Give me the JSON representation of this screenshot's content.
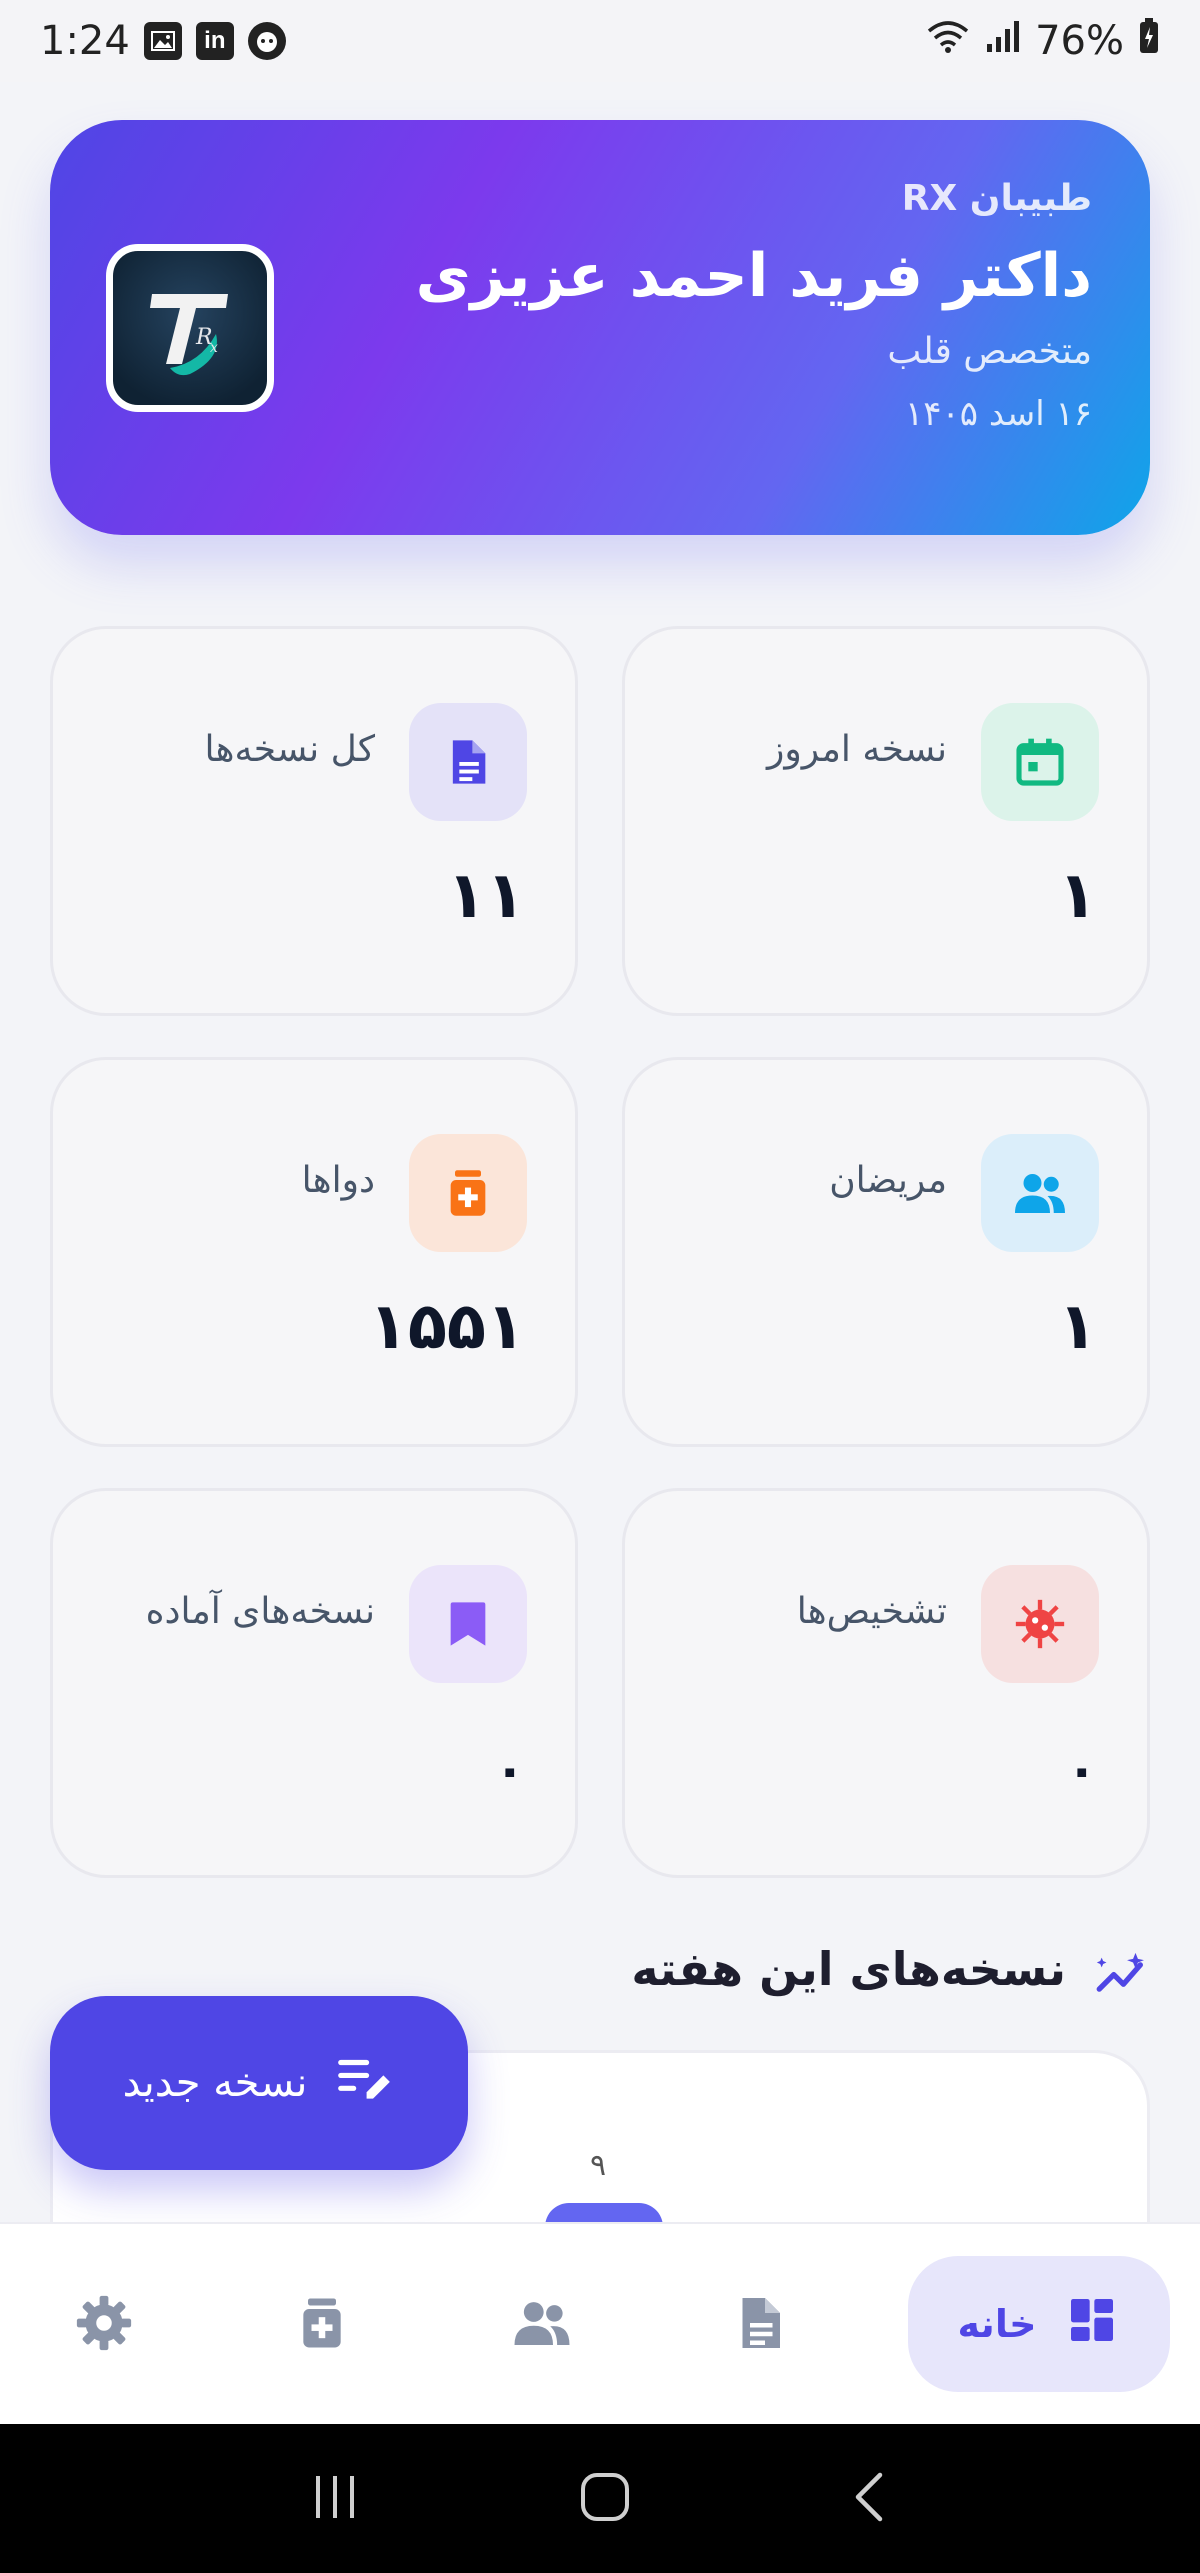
{
  "status_bar": {
    "time": "1:24",
    "battery": "76%"
  },
  "header": {
    "app_name": "طبیبان RX",
    "doctor_name": "داکتر فرید احمد عزیزی",
    "specialty": "متخصص قلب",
    "date": "۱۶ اسد ۱۴۰۵"
  },
  "stats": [
    {
      "label": "نسخه امروز",
      "value": "۱",
      "icon": "calendar-icon",
      "color": "#10b981",
      "bg": "#dcf3ea"
    },
    {
      "label": "کل نسخه‌ها",
      "value": "۱۱",
      "icon": "document-icon",
      "color": "#4f46e5",
      "bg": "#e4e2f8"
    },
    {
      "label": "مریضان",
      "value": "۱",
      "icon": "users-icon",
      "color": "#0ea5e9",
      "bg": "#dbeefa"
    },
    {
      "label": "دواها",
      "value": "۱۵۵۱",
      "icon": "medicine-icon",
      "color": "#f97316",
      "bg": "#fbe5d9"
    },
    {
      "label": "تشخیص‌ها",
      "value": "۰",
      "icon": "virus-icon",
      "color": "#ef4444",
      "bg": "#f6e0e0"
    },
    {
      "label": "نسخه‌های آماده",
      "value": "۰",
      "icon": "bookmark-icon",
      "color": "#8b5cf6",
      "bg": "#ebe4fa"
    }
  ],
  "weekly": {
    "title": "نسخه‌های این هفته",
    "bar_value_label": "۹"
  },
  "fab": {
    "label": "نسخه جدید"
  },
  "bottom_nav": {
    "home_label": "خانه",
    "items": [
      "settings-icon",
      "medicine-icon",
      "users-icon",
      "document-icon"
    ]
  }
}
